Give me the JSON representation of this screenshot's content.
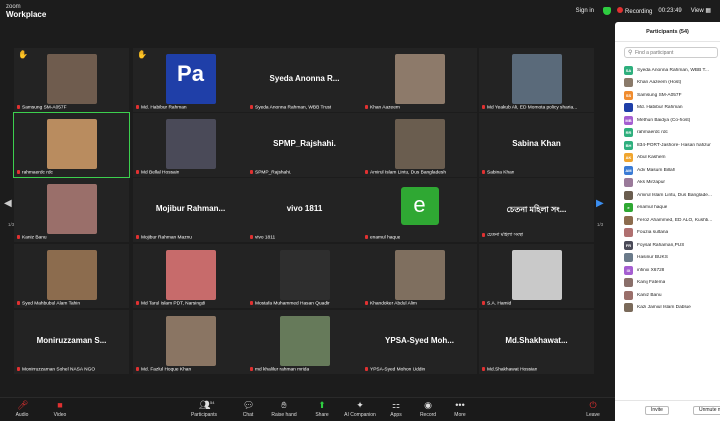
{
  "brand": {
    "line1": "zoom",
    "line2": "Workplace"
  },
  "topbar": {
    "signin": "Sign in",
    "recording": "Recording",
    "timer": "00:23:49",
    "view": "View"
  },
  "gallery": {
    "page_left": "1/3",
    "page_right": "1/3",
    "tiles": [
      {
        "name": "Samsung SM-A057F",
        "big": "",
        "photo": "#6f5c4e",
        "hand": true
      },
      {
        "name": "Md. Habibur Rahman",
        "big": "",
        "photo": "#1f3fa8",
        "hand": true,
        "photo_text": "Pa"
      },
      {
        "name": "Syeda Anonna Rahman, WBB Trust",
        "big": "Syeda Anonna R...",
        "photo": ""
      },
      {
        "name": "Khan Aazeem",
        "big": "",
        "photo": "#8d7a6a"
      },
      {
        "name": "Md Yeakub Ali, ED Momota policy sharia...",
        "big": "",
        "photo": "#5a6a7a"
      },
      {
        "name": "rahmaerdc rdc",
        "big": "",
        "photo": "#b98c5f",
        "active": true
      },
      {
        "name": "Md Bellal Hossain",
        "big": "",
        "photo": "#4a4a58"
      },
      {
        "name": "SPMP_Rajshahi.",
        "big": "SPMP_Rajshahi.",
        "photo": ""
      },
      {
        "name": "Amirul Islam Lintu, Dus Bangladesh",
        "big": "",
        "photo": "#6a5d4f"
      },
      {
        "name": "Sabina Khan",
        "big": "Sabina Khan",
        "photo": ""
      },
      {
        "name": "Kaniz Banu",
        "big": "",
        "photo": "#9a6f6a"
      },
      {
        "name": "Mojibur Rahman Maznu",
        "big": "Mojibur Rahman...",
        "photo": ""
      },
      {
        "name": "vivo 1811",
        "big": "vivo 1811",
        "photo": ""
      },
      {
        "name": "enamul haque",
        "big": "",
        "photo": "",
        "elogo": "e"
      },
      {
        "name": "চেতনা মহিলা সংস্থা",
        "big": "চেতনা মহিলা সং...",
        "photo": ""
      },
      {
        "name": "Syed Mahbubul Alam Tahin",
        "big": "",
        "photo": "#8c6c4e"
      },
      {
        "name": "Md Tarul Islam PDT, Narsingdi",
        "big": "",
        "photo": "#c76b6b"
      },
      {
        "name": "Mostafa Muhammed Hasan Quadir",
        "big": "",
        "photo": "#2e2e2e"
      },
      {
        "name": "Khandoker Abdul Alim",
        "big": "",
        "photo": "#7f6f5f"
      },
      {
        "name": "S.A. Hamid",
        "big": "",
        "photo": "#c9c9c9"
      },
      {
        "name": "Monirruzzaman Sohel NASA NGO",
        "big": "Moniruzzaman S...",
        "photo": ""
      },
      {
        "name": "Md. Fazlul Hoque Khan",
        "big": "",
        "photo": "#8a7563"
      },
      {
        "name": "md khalilur rahman mrida",
        "big": "",
        "photo": "#667a5a"
      },
      {
        "name": "YPSA-Syed Mohon Uddin",
        "big": "YPSA-Syed Moh...",
        "photo": ""
      },
      {
        "name": "Md.Shakhawat Hossian",
        "big": "Md.Shakhawat...",
        "photo": ""
      }
    ]
  },
  "toolbar": {
    "audio": "Audio",
    "video": "Video",
    "participants": "Participants",
    "participants_count": "54",
    "chat": "Chat",
    "raise_hand": "Raise hand",
    "share": "Share",
    "ai": "AI Companion",
    "apps": "Apps",
    "record": "Record",
    "more": "More",
    "leave": "Leave"
  },
  "panel": {
    "title": "Participants (54)",
    "search_placeholder": "Find a participant",
    "invite": "Invite",
    "unmute": "Unmute me",
    "participants": [
      {
        "initials": "SA",
        "color": "#2eaf7d",
        "name": "Syeda Anonna Rahman, WBB T..."
      },
      {
        "initials": "",
        "color": "#8a7a6a",
        "name": "Khan Aazeem (Host)"
      },
      {
        "initials": "SS",
        "color": "#f08c2e",
        "name": "Samsung SM-A057F"
      },
      {
        "initials": "",
        "color": "#1f3fa8",
        "name": "Md. Habibur Rahman"
      },
      {
        "initials": "MB",
        "color": "#a55ed1",
        "name": "Methun Baidya (Co-host)"
      },
      {
        "initials": "RR",
        "color": "#2eaf7d",
        "name": "rahmaerdc rdc"
      },
      {
        "initials": "BH",
        "color": "#2eaf7d",
        "name": "834-PORT-Jashore- Hasan hafizur"
      },
      {
        "initials": "AK",
        "color": "#f0a52e",
        "name": "Abul Kashem"
      },
      {
        "initials": "AM",
        "color": "#3a7bd5",
        "name": "Adv Masum Billah"
      },
      {
        "initials": "",
        "color": "#9a7a9a",
        "name": "Aks Mirzapur"
      },
      {
        "initials": "",
        "color": "#6a5d4f",
        "name": "Amirul Islam Lintu, Dus Banglade..."
      },
      {
        "initials": "e",
        "color": "#2fa833",
        "name": "enamul haque"
      },
      {
        "initials": "",
        "color": "#8c6c4e",
        "name": "Feroz Ahammed, ED ALO, Kushti..."
      },
      {
        "initials": "",
        "color": "#b07070",
        "name": "Fouzia sultana"
      },
      {
        "initials": "FR",
        "color": "#4a4a58",
        "name": "Foysal Rahaman,PUS"
      },
      {
        "initials": "",
        "color": "#6a7a8a",
        "name": "Hasinur BUKS"
      },
      {
        "initials": "IX",
        "color": "#a55ed1",
        "name": "infinix X6728"
      },
      {
        "initials": "",
        "color": "#8a6f6a",
        "name": "Kanij Fatema"
      },
      {
        "initials": "",
        "color": "#9a6f6a",
        "name": "Kaniz Banu"
      },
      {
        "initials": "",
        "color": "#7a6a5a",
        "name": "Kazi Jamiul Islam Dablue"
      }
    ]
  }
}
